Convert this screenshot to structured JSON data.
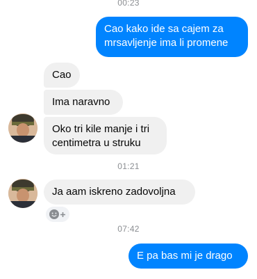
{
  "conversation": {
    "timestamps": [
      "00:23",
      "01:21",
      "07:42"
    ],
    "messages": [
      {
        "from": "me",
        "lines": [
          "Cao kako ide sa cajem za",
          "mrsavljenje ima li promene"
        ]
      },
      {
        "from": "them",
        "lines": [
          "Cao"
        ]
      },
      {
        "from": "them",
        "lines": [
          "Ima naravno"
        ]
      },
      {
        "from": "them",
        "lines": [
          "Oko tri kile manje i tri",
          "centimetra u struku"
        ]
      },
      {
        "from": "them",
        "lines": [
          "Ja aam iskreno zadovoljna"
        ]
      },
      {
        "from": "me",
        "lines": [
          "E pa bas mi je drago"
        ]
      }
    ]
  },
  "colors": {
    "outgoing_bubble": "#0084ff",
    "incoming_bubble": "#f0f0f0",
    "timestamp_text": "#8a8d91"
  },
  "icons": {
    "reaction": "smiley-plus-icon",
    "avatar": "contact-avatar"
  }
}
